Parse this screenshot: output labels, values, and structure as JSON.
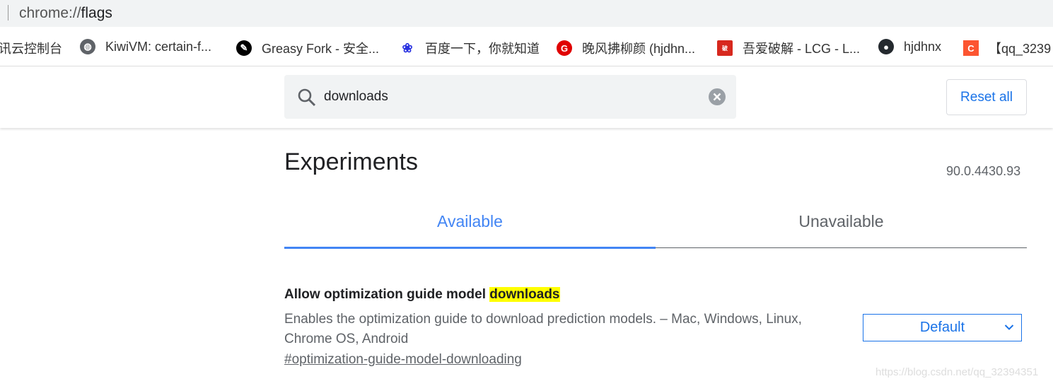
{
  "address_bar": {
    "scheme": "chrome://",
    "path": "flags"
  },
  "bookmarks": [
    {
      "label": "讯云控制台",
      "icon": "tencent-cloud-icon",
      "color": "#00a3ff"
    },
    {
      "label": "KiwiVM: certain-f...",
      "icon": "globe-icon",
      "color": "#5f6368"
    },
    {
      "label": "Greasy Fork - 安全...",
      "icon": "greasyfork-icon",
      "color": "#000000"
    },
    {
      "label": "百度一下，你就知道",
      "icon": "baidu-icon",
      "color": "#2932e1"
    },
    {
      "label": "晚风拂柳颜 (hjdhn...",
      "icon": "gitee-icon",
      "color": "#e00000"
    },
    {
      "label": "吾爱破解 - LCG - L...",
      "icon": "52pojie-icon",
      "color": "#d7281e"
    },
    {
      "label": "hjdhnx",
      "icon": "github-icon",
      "color": "#24292e"
    },
    {
      "label": "【qq_3239",
      "icon": "csdn-icon",
      "color": "#fc5531"
    }
  ],
  "search": {
    "value": "downloads"
  },
  "reset_label": "Reset all",
  "title": "Experiments",
  "version": "90.0.4430.93",
  "tabs": [
    {
      "label": "Available",
      "active": true
    },
    {
      "label": "Unavailable",
      "active": false
    }
  ],
  "flag": {
    "name_prefix": "Allow optimization guide model ",
    "name_highlight": "downloads",
    "description": "Enables the optimization guide to download prediction models. – Mac, Windows, Linux, Chrome OS, Android",
    "link": "#optimization-guide-model-downloading",
    "select_value": "Default"
  },
  "watermark": "https://blog.csdn.net/qq_32394351"
}
